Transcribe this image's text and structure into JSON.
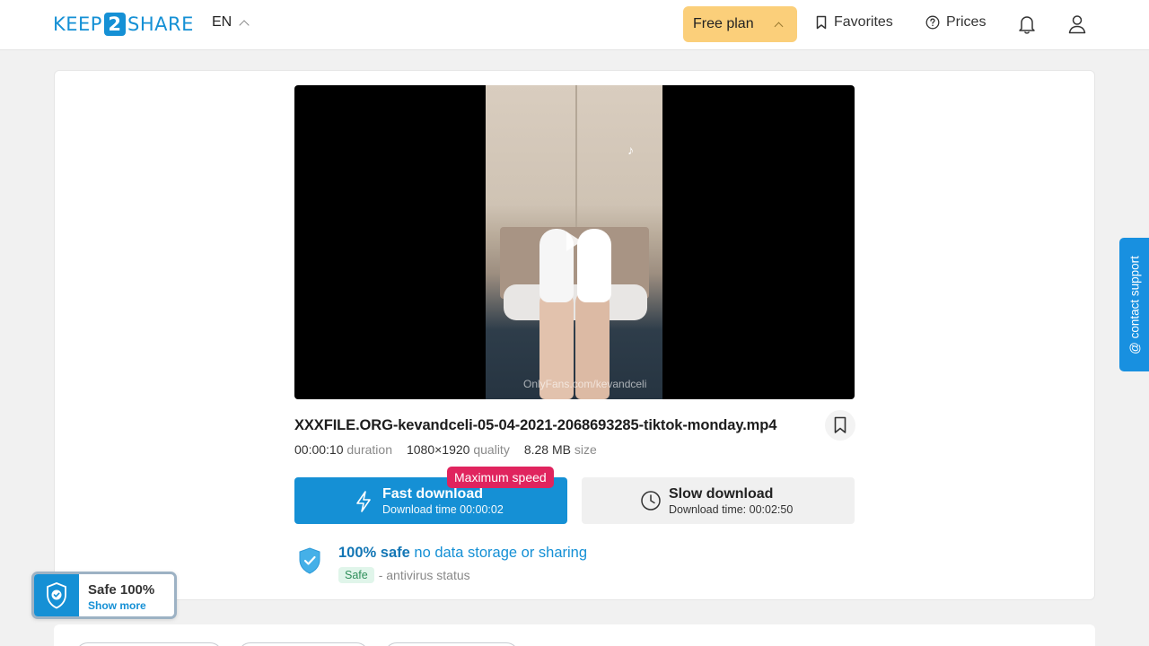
{
  "header": {
    "logo_left": "KEEP",
    "logo_mid": "2",
    "logo_right": "SHARE",
    "language": "EN",
    "plan_label": "Free plan",
    "favorites_label": "Favorites",
    "prices_label": "Prices",
    "icons": [
      "bookmark-icon",
      "help-circle-icon",
      "bell-icon",
      "user-icon",
      "chevron-up-icon"
    ]
  },
  "video": {
    "watermark": "OnlyFans.com/kevandceli",
    "tiktok_mark": "♪"
  },
  "file": {
    "name": "XXXFILE.ORG-kevandceli-05-04-2021-2068693285-tiktok-monday.mp4",
    "duration": "00:00:10",
    "duration_unit": "duration",
    "resolution": "1080×1920",
    "resolution_unit": "quality",
    "size": "8.28 MB",
    "size_unit": "size"
  },
  "download": {
    "fast_label": "Fast download",
    "fast_time": "Download time 00:00:02",
    "max_speed_badge": "Maximum speed",
    "slow_label": "Slow download",
    "slow_time": "Download time: 00:02:50"
  },
  "safety": {
    "title_bold": "100% safe",
    "title_rest": " no data storage or sharing",
    "badge": "Safe",
    "status": "- antivirus status"
  },
  "contact_support": "@ contact support",
  "safe_popup": {
    "title": "Safe 100%",
    "link": "Show more"
  },
  "colors": {
    "brand": "#1590d5",
    "plan": "#fbcf7a",
    "badge": "#e0245e",
    "safe_badge_bg": "#e0f5ea"
  }
}
